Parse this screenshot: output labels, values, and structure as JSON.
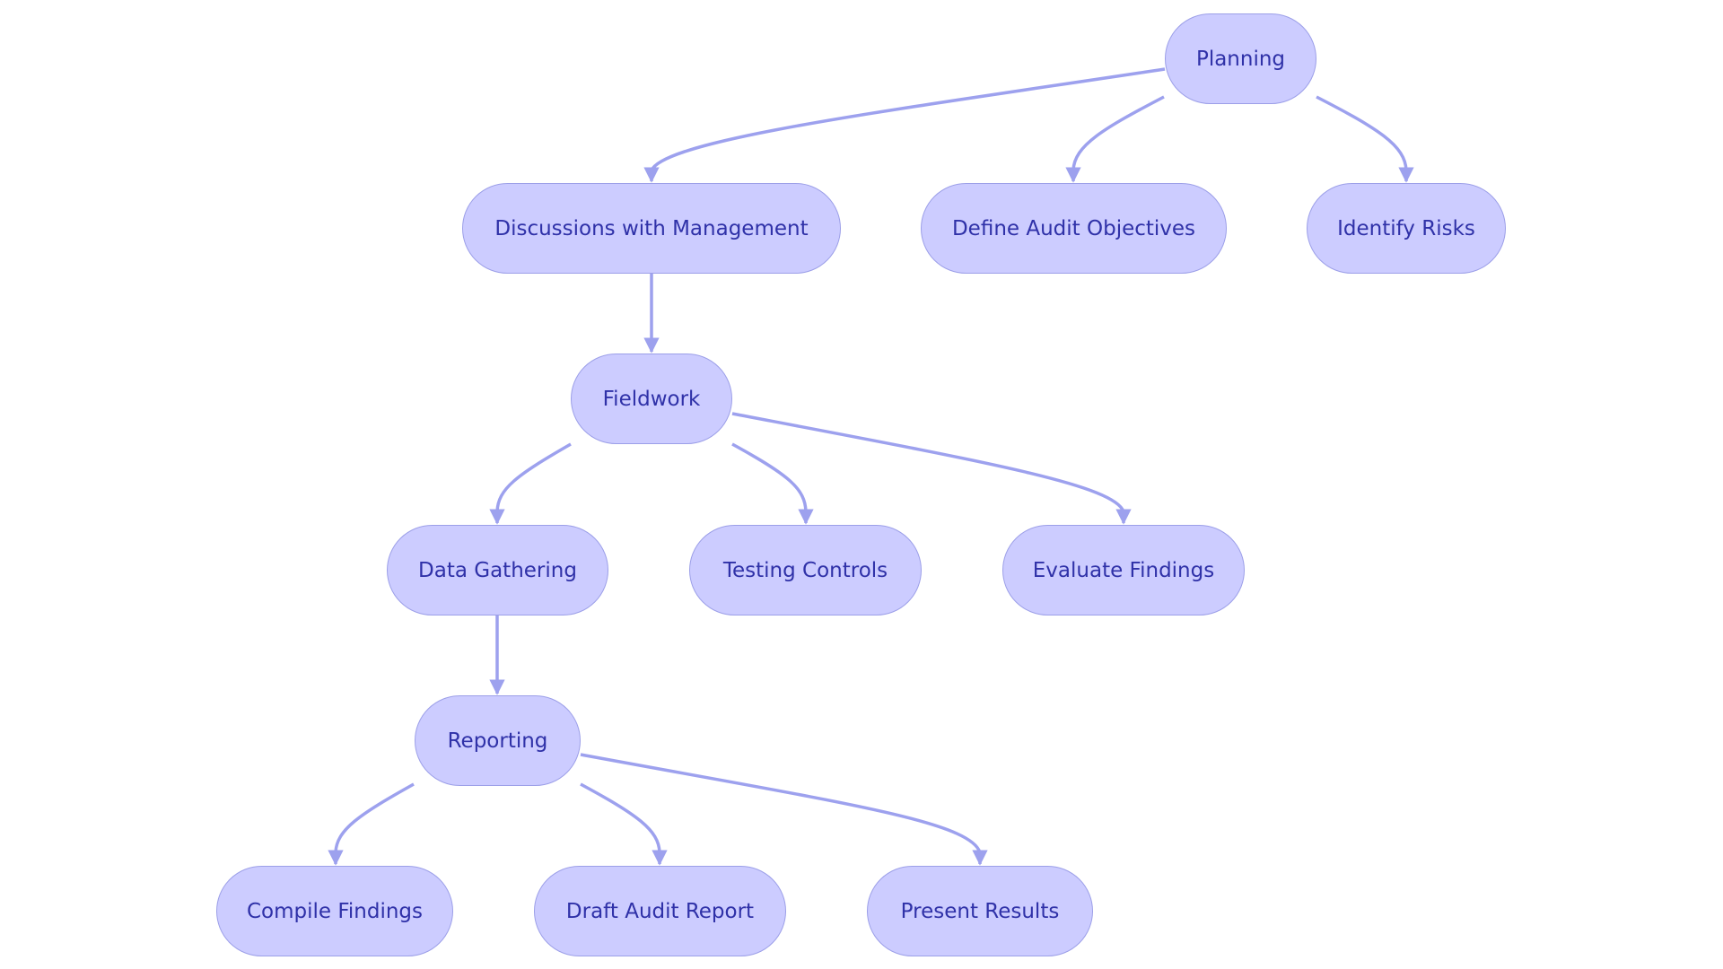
{
  "diagram": {
    "type": "flowchart-tree",
    "colors": {
      "node_fill": "#ccccff",
      "node_border": "#9c9fe8",
      "text": "#2f31a8",
      "edge": "#9da1ee"
    },
    "nodes": [
      {
        "id": "planning",
        "label": "Planning"
      },
      {
        "id": "discussions",
        "label": "Discussions with Management"
      },
      {
        "id": "objectives",
        "label": "Define Audit Objectives"
      },
      {
        "id": "risks",
        "label": "Identify Risks"
      },
      {
        "id": "fieldwork",
        "label": "Fieldwork"
      },
      {
        "id": "gathering",
        "label": "Data Gathering"
      },
      {
        "id": "testing",
        "label": "Testing Controls"
      },
      {
        "id": "evaluate",
        "label": "Evaluate Findings"
      },
      {
        "id": "reporting",
        "label": "Reporting"
      },
      {
        "id": "compile",
        "label": "Compile Findings"
      },
      {
        "id": "draft",
        "label": "Draft Audit Report"
      },
      {
        "id": "present",
        "label": "Present Results"
      }
    ],
    "edges": [
      {
        "from": "planning",
        "to": "discussions"
      },
      {
        "from": "planning",
        "to": "objectives"
      },
      {
        "from": "planning",
        "to": "risks"
      },
      {
        "from": "discussions",
        "to": "fieldwork"
      },
      {
        "from": "fieldwork",
        "to": "gathering"
      },
      {
        "from": "fieldwork",
        "to": "testing"
      },
      {
        "from": "fieldwork",
        "to": "evaluate"
      },
      {
        "from": "gathering",
        "to": "reporting"
      },
      {
        "from": "reporting",
        "to": "compile"
      },
      {
        "from": "reporting",
        "to": "draft"
      },
      {
        "from": "reporting",
        "to": "present"
      }
    ]
  }
}
